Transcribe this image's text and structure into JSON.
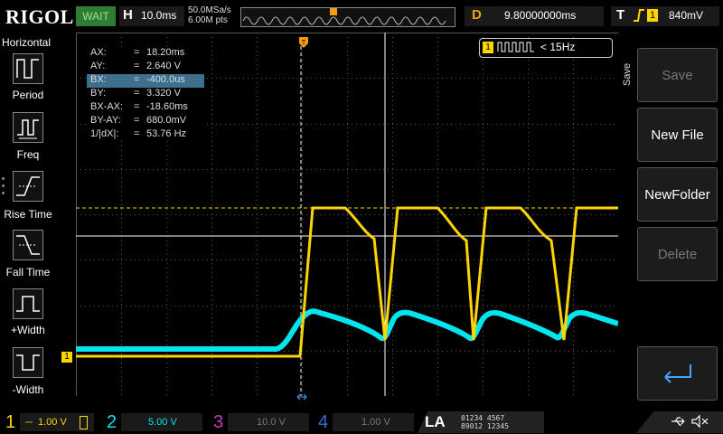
{
  "brand": "RIGOL",
  "status": "WAIT",
  "horizontal": {
    "label": "H",
    "timebase": "10.0ms",
    "sample_rate": "50.0MSa/s",
    "points": "6.00M pts"
  },
  "delay": {
    "label": "D",
    "value": "9.80000000ms"
  },
  "trigger": {
    "label": "T",
    "edge_icon": "rising-edge-icon",
    "channel": "1",
    "level": "840mV"
  },
  "left_menu": {
    "title": "Horizontal",
    "items": [
      {
        "label": "Period",
        "icon": "period-icon"
      },
      {
        "label": "Freq",
        "icon": "freq-icon"
      },
      {
        "label": "Rise Time",
        "icon": "rise-time-icon"
      },
      {
        "label": "Fall Time",
        "icon": "fall-time-icon"
      },
      {
        "label": "+Width",
        "icon": "pos-width-icon"
      },
      {
        "label": "-Width",
        "icon": "neg-width-icon"
      }
    ]
  },
  "cursor_readout": [
    {
      "key": "AX:",
      "eq": "=",
      "value": "18.20ms"
    },
    {
      "key": "AY:",
      "eq": "=",
      "value": "2.640 V"
    },
    {
      "key": "BX:",
      "eq": "=",
      "value": "-400.0us"
    },
    {
      "key": "BY:",
      "eq": "=",
      "value": "3.320 V"
    },
    {
      "key": "BX-AX:",
      "eq": "=",
      "value": "-18.60ms"
    },
    {
      "key": "BY-AY:",
      "eq": "=",
      "value": "680.0mV"
    },
    {
      "key": "1/|dX|:",
      "eq": "=",
      "value": "53.76 Hz"
    }
  ],
  "freq_counter": {
    "channel": "1",
    "value": "< 15Hz"
  },
  "right_menu": {
    "title": "Save",
    "buttons": [
      {
        "label": "Save",
        "enabled": false
      },
      {
        "label": "New File",
        "enabled": true
      },
      {
        "label": "NewFolder",
        "enabled": true
      },
      {
        "label": "Delete",
        "enabled": false
      },
      {
        "label": "",
        "enabled": true,
        "icon": "enter-arrow-icon"
      }
    ]
  },
  "channels": [
    {
      "num": "1",
      "scale": "1.00 V",
      "color": "#ffd400",
      "active": true
    },
    {
      "num": "2",
      "scale": "5.00 V",
      "color": "#00e5ee",
      "active": true
    },
    {
      "num": "3",
      "scale": "10.0 V",
      "color": "#c03cb4",
      "active": false
    },
    {
      "num": "4",
      "scale": "1.00 V",
      "color": "#2f6fd6",
      "active": false
    }
  ],
  "la": {
    "label": "LA",
    "row1": "01234 4567",
    "row2": "89012 12345"
  },
  "markers": {
    "ch1": "1",
    "trig_right": "T",
    "cursor_a": "A",
    "cursor_b": "B"
  },
  "colors": {
    "ch1": "#ffd400",
    "ch2": "#00e5ee",
    "trigger": "#f39c12",
    "grid": "#555555"
  }
}
